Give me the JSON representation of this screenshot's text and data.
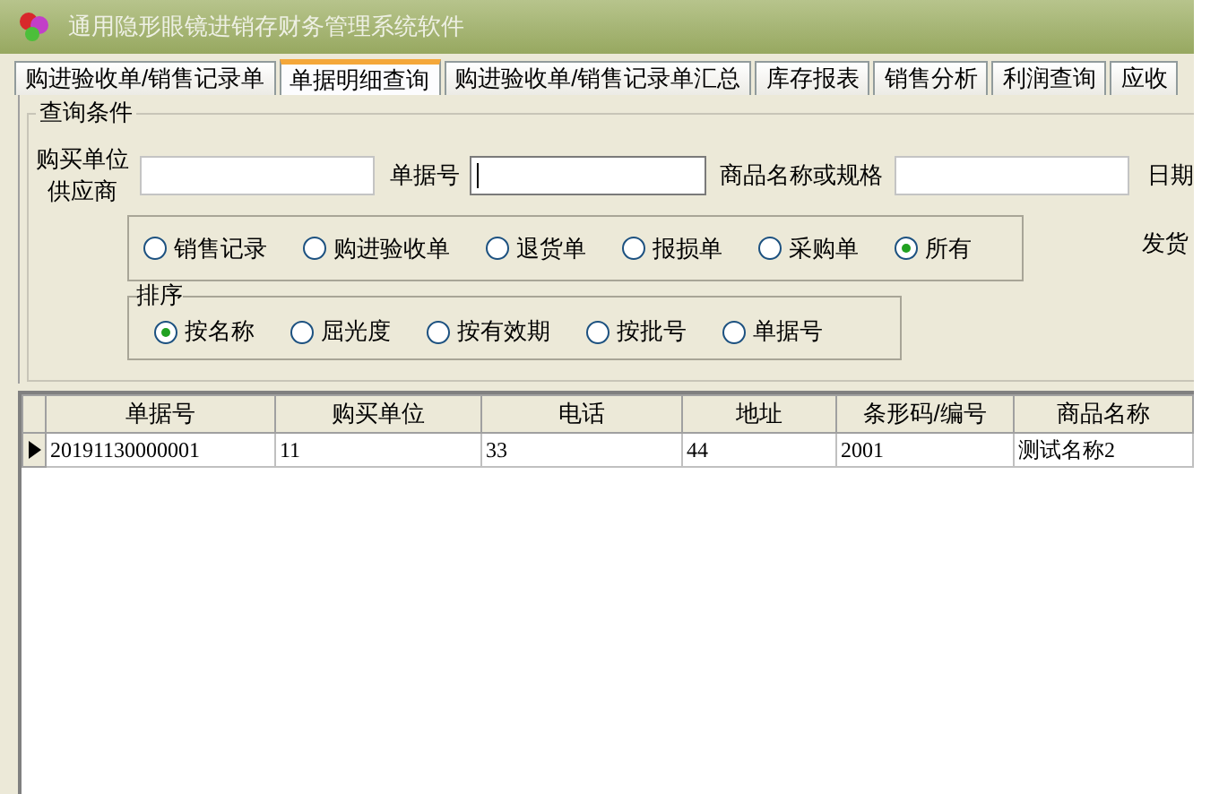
{
  "window": {
    "title": "通用隐形眼镜进销存财务管理系统软件"
  },
  "tabs": [
    {
      "label": "购进验收单/销售记录单",
      "selected": false
    },
    {
      "label": "单据明细查询",
      "selected": true
    },
    {
      "label": "购进验收单/销售记录单汇总",
      "selected": false
    },
    {
      "label": "库存报表",
      "selected": false
    },
    {
      "label": "销售分析",
      "selected": false
    },
    {
      "label": "利润查询",
      "selected": false
    },
    {
      "label": "应收",
      "selected": false
    }
  ],
  "query": {
    "title": "查询条件",
    "fields": [
      {
        "label": "购买单位",
        "sublabel": "供应商",
        "focused": false
      },
      {
        "label": "单据号",
        "focused": true
      },
      {
        "label": "商品名称或规格",
        "focused": false
      }
    ],
    "date_label": "日期",
    "ship_label": "发货",
    "record_types": [
      {
        "label": "销售记录",
        "selected": false
      },
      {
        "label": "购进验收单",
        "selected": false
      },
      {
        "label": "退货单",
        "selected": false
      },
      {
        "label": "报损单",
        "selected": false
      },
      {
        "label": "采购单",
        "selected": false
      },
      {
        "label": "所有",
        "selected": true
      }
    ],
    "sort": {
      "title": "排序",
      "options": [
        {
          "label": "按名称",
          "selected": true
        },
        {
          "label": "屈光度",
          "selected": false
        },
        {
          "label": "按有效期",
          "selected": false
        },
        {
          "label": "按批号",
          "selected": false
        },
        {
          "label": "单据号",
          "selected": false
        }
      ]
    }
  },
  "table": {
    "columns": [
      "单据号",
      "购买单位",
      "电话",
      "地址",
      "条形码/编号",
      "商品名称"
    ],
    "rows": [
      {
        "current": true,
        "cells": [
          "20191130000001",
          "11",
          "33",
          "44",
          "2001",
          "测试名称2"
        ]
      }
    ]
  }
}
